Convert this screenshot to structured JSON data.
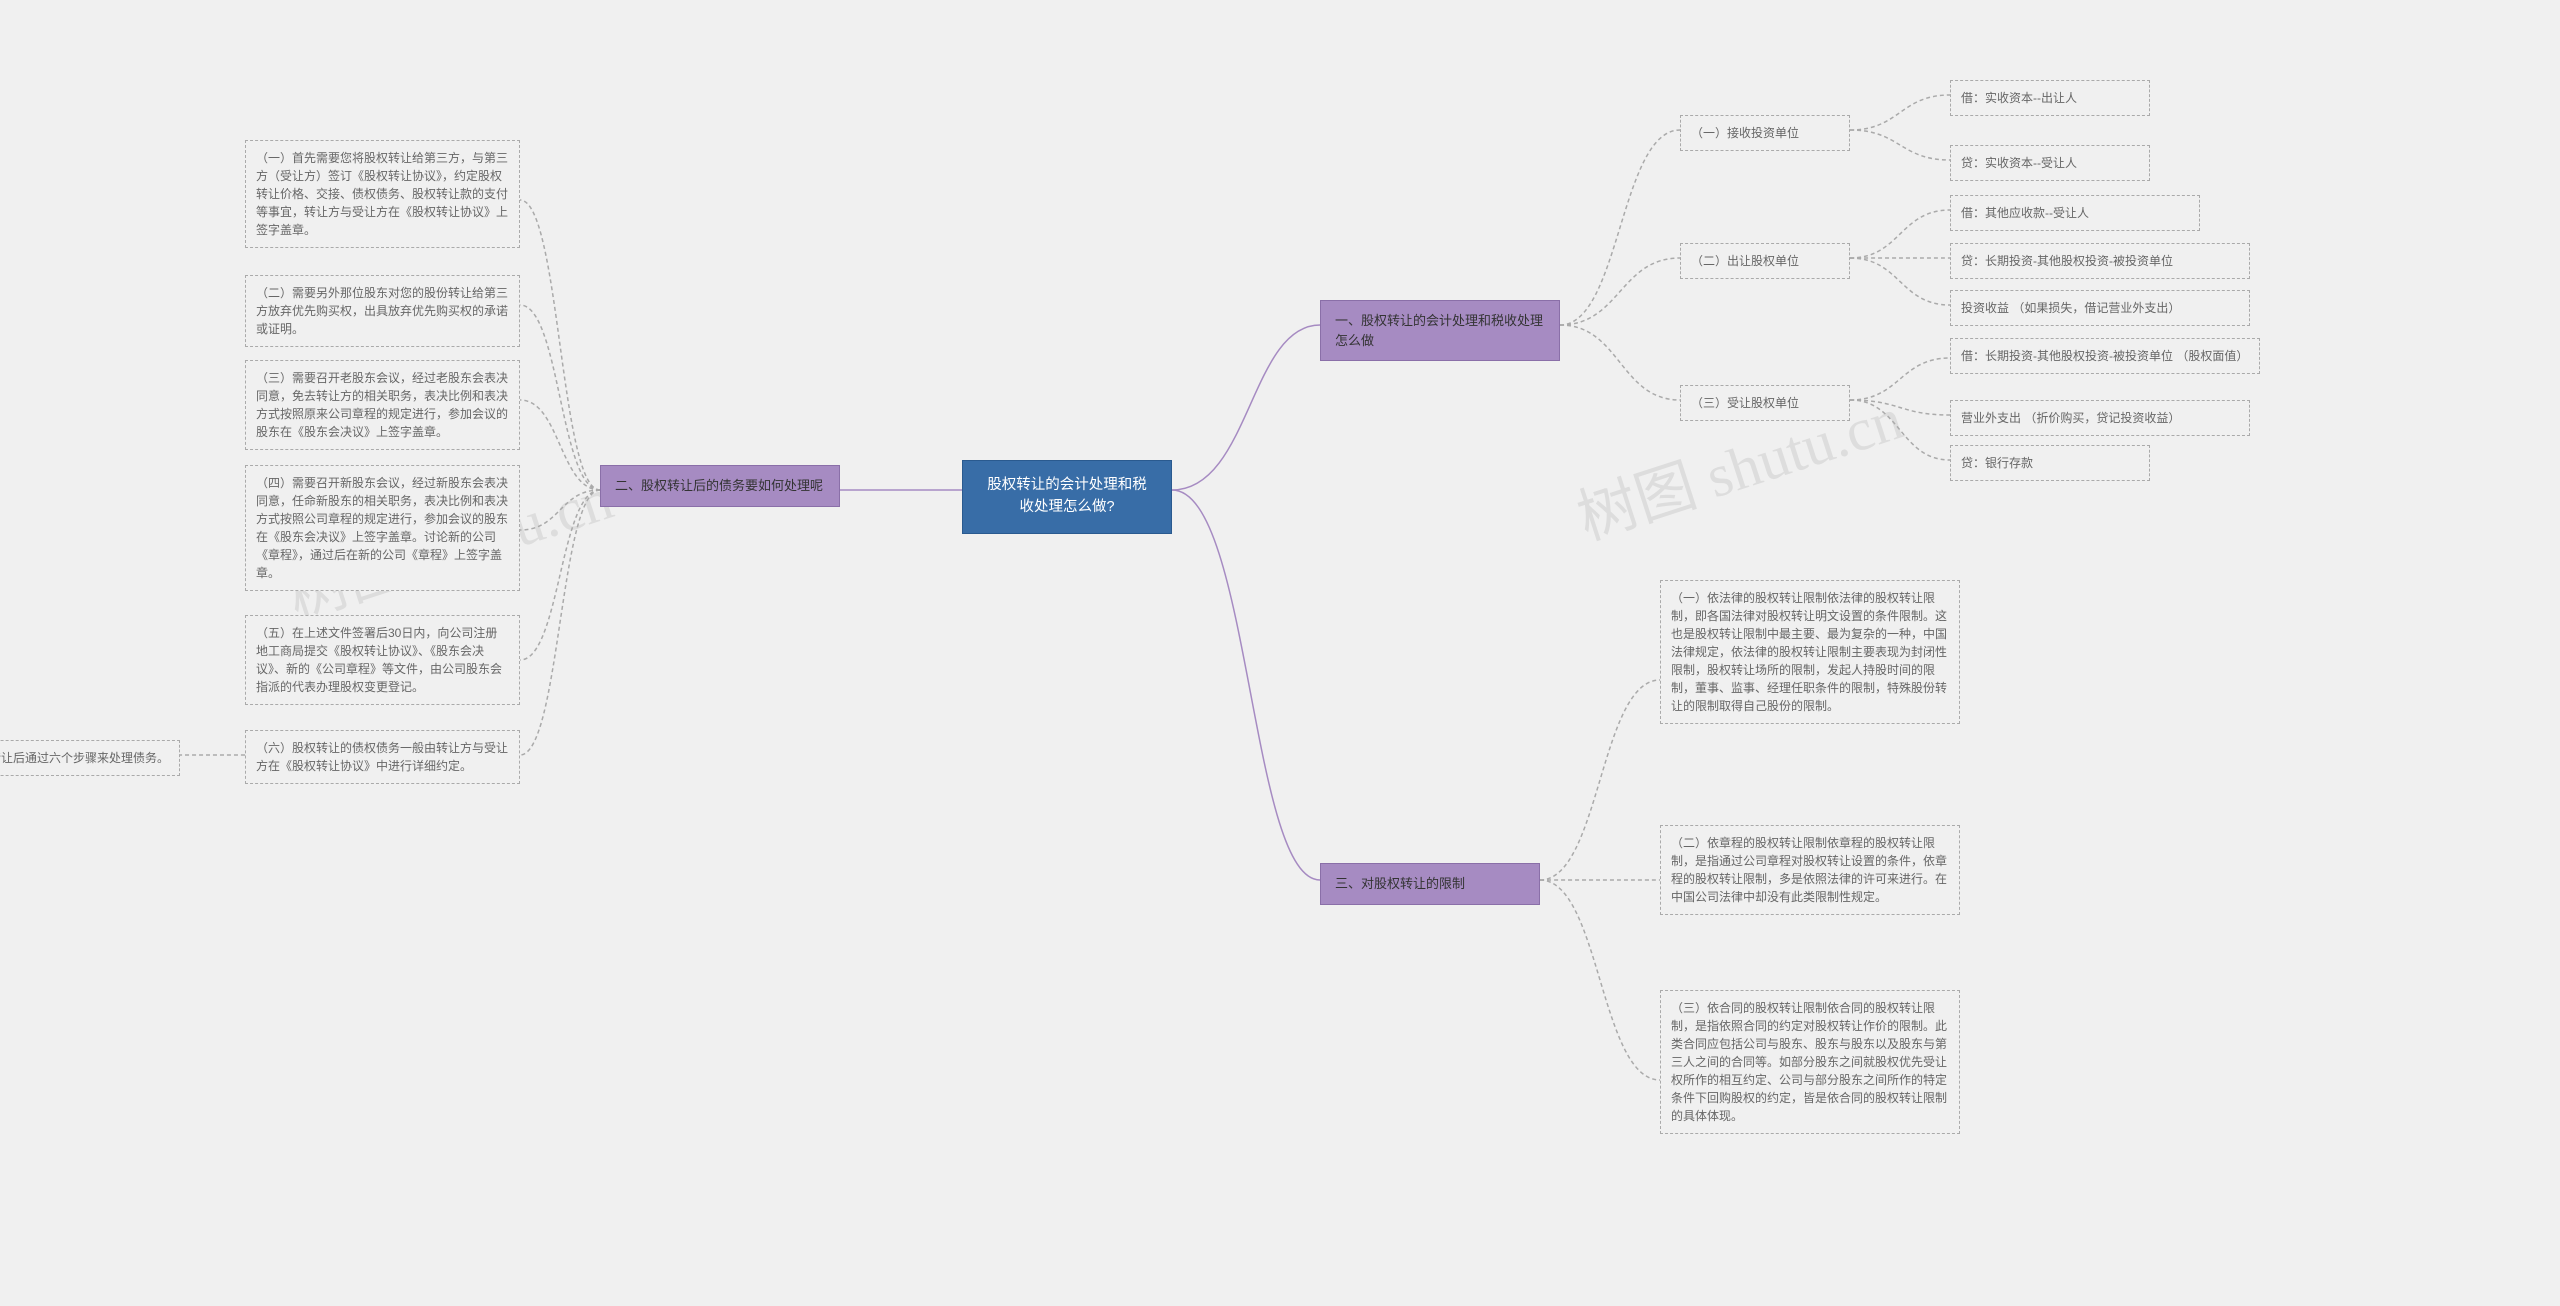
{
  "center": "股权转让的会计处理和税收处理怎么做?",
  "branch1": {
    "title": "一、股权转让的会计处理和税收处理怎么做",
    "sub1": {
      "title": "（一）接收投资单位",
      "items": [
        "借：实收资本--出让人",
        "贷：实收资本--受让人"
      ]
    },
    "sub2": {
      "title": "（二）出让股权单位",
      "items": [
        "借：其他应收款--受让人",
        "贷：长期投资-其他股权投资-被投资单位",
        "投资收益 （如果损失，借记营业外支出）"
      ]
    },
    "sub3": {
      "title": "（三）受让股权单位",
      "items": [
        "借：长期投资-其他股权投资-被投资单位 （股权面值）",
        "营业外支出 （折价购买，贷记投资收益）",
        "贷：银行存款"
      ]
    }
  },
  "branch2": {
    "title": "二、股权转让后的债务要如何处理呢",
    "items": [
      "（一）首先需要您将股权转让给第三方，与第三方（受让方）签订《股权转让协议》，约定股权转让价格、交接、债权债务、股权转让款的支付等事宜，转让方与受让方在《股权转让协议》上签字盖章。",
      "（二）需要另外那位股东对您的股份转让给第三方放弃优先购买权，出具放弃优先购买权的承诺或证明。",
      "（三）需要召开老股东会议，经过老股东会表决同意，免去转让方的相关职务，表决比例和表决方式按照原来公司章程的规定进行，参加会议的股东在《股东会决议》上签字盖章。",
      "（四）需要召开新股东会议，经过新股东会表决同意，任命新股东的相关职务，表决比例和表决方式按照公司章程的规定进行，参加会议的股东在《股东会决议》上签字盖章。讨论新的公司《章程》，通过后在新的公司《章程》上签字盖章。",
      "（五）在上述文件签署后30日内，向公司注册地工商局提交《股权转让协议》、《股东会决议》、新的《公司章程》等文件，由公司股东会指派的代表办理股权变更登记。",
      "（六）股权转让的债权债务一般由转让方与受让方在《股权转让协议》中进行详细约定。"
    ],
    "extra": "通常股权转让后通过六个步骤来处理债务。"
  },
  "branch3": {
    "title": "三、对股权转让的限制",
    "items": [
      "（一）依法律的股权转让限制依法律的股权转让限制，即各国法律对股权转让明文设置的条件限制。这也是股权转让限制中最主要、最为复杂的一种，中国法律规定，依法律的股权转让限制主要表现为封闭性限制，股权转让场所的限制，发起人持股时间的限制，董事、监事、经理任职条件的限制，特殊股份转让的限制取得自己股份的限制。",
      "（二）依章程的股权转让限制依章程的股权转让限制，是指通过公司章程对股权转让设置的条件，依章程的股权转让限制，多是依照法律的许可来进行。在中国公司法律中却没有此类限制性规定。",
      "（三）依合同的股权转让限制依合同的股权转让限制，是指依照合同的约定对股权转让作价的限制。此类合同应包括公司与股东、股东与股东以及股东与第三人之间的合同等。如部分股东之间就股权优先受让权所作的相互约定、公司与部分股东之间所作的特定条件下回购股权的约定，皆是依合同的股权转让限制的具体体现。"
    ]
  },
  "watermarks": [
    "树图 shutu.cn",
    "树图 shutu.cn"
  ]
}
